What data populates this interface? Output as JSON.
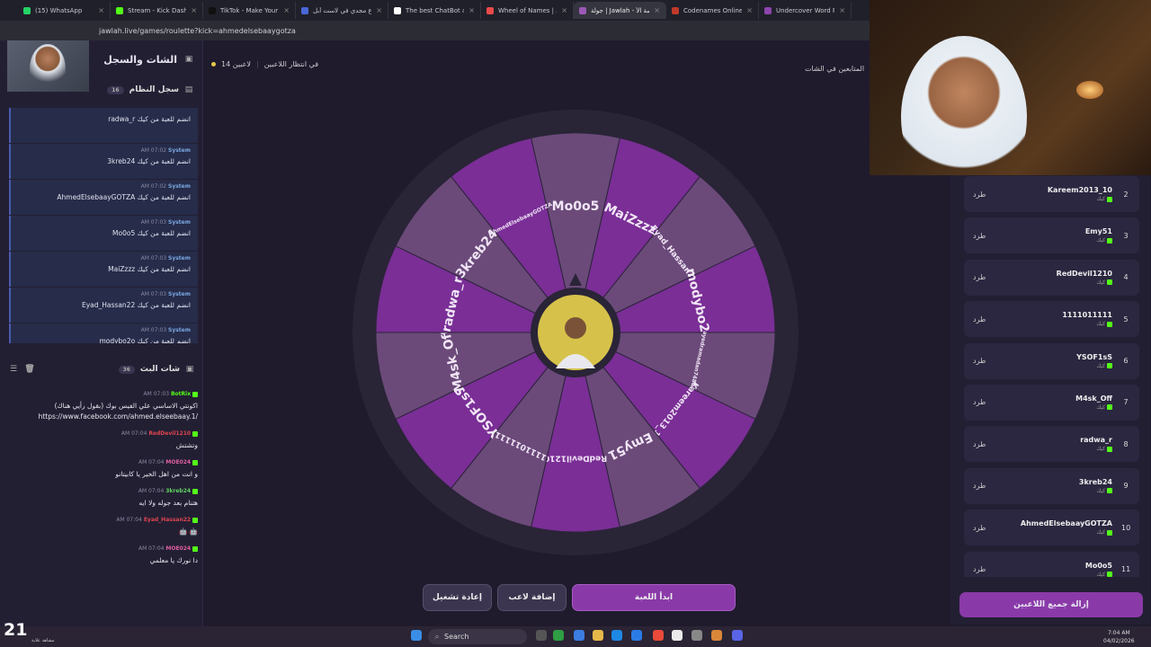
{
  "browser": {
    "tabs": [
      {
        "label": "(15) WhatsApp",
        "color": "#25d366"
      },
      {
        "label": "Stream - Kick Dashboard",
        "color": "#53fc18"
      },
      {
        "label": "TikTok - Make Your Day",
        "color": "#111111"
      },
      {
        "label": "الفرع مجدي في لاست أبل",
        "color": "#4a67d6"
      },
      {
        "label": "The best ChatBot and W",
        "color": "#ffffff"
      },
      {
        "label": "Wheel of Names | تواكي",
        "color": "#e94a4a"
      },
      {
        "label": "جولة | Jawlah - منصة الأ",
        "color": "#9b59b6"
      },
      {
        "label": "Codenames Online",
        "color": "#c0392b"
      },
      {
        "label": "Undercover Word Party",
        "color": "#8e44ad"
      }
    ],
    "url": "jawlah.live/games/roulette?kick=ahmedelsebaaygotza"
  },
  "left_panel": {
    "title": "الشات والسجل",
    "system_log": {
      "title": "سجل النظام",
      "count": "16"
    },
    "system_messages": [
      {
        "time": "",
        "who": "",
        "text": "radwa_r انضم للعبة من كيك"
      },
      {
        "time": "AM 07:02",
        "who": "System",
        "text": "3kreb24 انضم للعبة من كيك"
      },
      {
        "time": "AM 07:02",
        "who": "System",
        "text": "AhmedElsebaayGOTZA انضم للعبة من كيك"
      },
      {
        "time": "AM 07:03",
        "who": "System",
        "text": "Mo0o5 انضم للعبة من كيك"
      },
      {
        "time": "AM 07:03",
        "who": "System",
        "text": "MaiZzzz انضم للعبة من كيك"
      },
      {
        "time": "AM 07:03",
        "who": "System",
        "text": "Eyad_Hassan22 انضم للعبة من كيك"
      },
      {
        "time": "AM 07:03",
        "who": "System",
        "text": "modybo2o انضم للعبة من كيك"
      }
    ],
    "bot_chat": {
      "title": "شات البث",
      "count": "36"
    },
    "chat_messages": [
      {
        "time": "AM 07:03",
        "user": "BotRix",
        "color": "#53fc18",
        "text": "اكونتي الاساسي علي الفيس بوك (بقول رأيي هناك) https://www.facebook.com/ahmed.elseebaay.1/"
      },
      {
        "time": "AM 07:04",
        "user": "RedDevil1210",
        "color": "#e0454f",
        "text": "وتشتش"
      },
      {
        "time": "AM 07:04",
        "user": "MOE024",
        "color": "#e05fa0",
        "text": "و انت من اهل الخير يا كابيتانو"
      },
      {
        "time": "AM 07:04",
        "user": "3kreb24",
        "color": "#5fd35f",
        "text": "هتنام بعد جوله ولا ايه"
      },
      {
        "time": "AM 07:04",
        "user": "Eyad_Hassan22",
        "color": "#e0454f",
        "text": "🤖 🤖"
      },
      {
        "time": "AM 07:04",
        "user": "MOE024",
        "color": "#e05fa0",
        "text": "دا نورك يا معلمي"
      }
    ]
  },
  "game": {
    "players_count": "14 لاعبين",
    "status": "في انتظار اللاعبين",
    "followers_label": "المتابعين في الشات",
    "wheel_segments": [
      "Mo0o5",
      "MaiZzzz",
      "Eyad_Hassan22",
      "modybo2o",
      "ayedramadan74864",
      "Kareem2013_10",
      "Emy51",
      "RedDevil1210",
      "1111011111",
      "YSOF1sS",
      "M4sk_Off",
      "radwa_r",
      "3kreb24",
      "AhmedElsebaayGOTZA"
    ],
    "buttons": {
      "restart": "إعادة تشغيل",
      "add_player": "إضافة لاعب",
      "start": "ابدأ اللعبة"
    }
  },
  "right_panel": {
    "players": [
      {
        "num": "2",
        "name": "Kareem2013_10",
        "source": "كيك",
        "kick": "طرد"
      },
      {
        "num": "3",
        "name": "Emy51",
        "source": "كيك",
        "kick": "طرد"
      },
      {
        "num": "4",
        "name": "RedDevil1210",
        "source": "كيك",
        "kick": "طرد"
      },
      {
        "num": "5",
        "name": "1111011111",
        "source": "كيك",
        "kick": "طرد"
      },
      {
        "num": "6",
        "name": "YSOF1sS",
        "source": "كيك",
        "kick": "طرد"
      },
      {
        "num": "7",
        "name": "M4sk_Off",
        "source": "كيك",
        "kick": "طرد"
      },
      {
        "num": "8",
        "name": "radwa_r",
        "source": "كيك",
        "kick": "طرد"
      },
      {
        "num": "9",
        "name": "3kreb24",
        "source": "كيك",
        "kick": "طرد"
      },
      {
        "num": "10",
        "name": "AhmedElsebaayGOTZA",
        "source": "كيك",
        "kick": "طرد"
      },
      {
        "num": "11",
        "name": "Mo0o5",
        "source": "كيك",
        "kick": "طرد"
      }
    ],
    "clear_button": "إزالة جميع اللاعبين"
  },
  "taskbar": {
    "search": "Search",
    "time": "7:04 AM",
    "date": "04/02/2026"
  },
  "overlay": {
    "viewers": "21",
    "viewers_label": "مشاهد علاية"
  },
  "colors": {
    "accent": "#8a3aa8",
    "wheel_dark": "#7a2e96",
    "wheel_light": "#6b4a7a"
  }
}
